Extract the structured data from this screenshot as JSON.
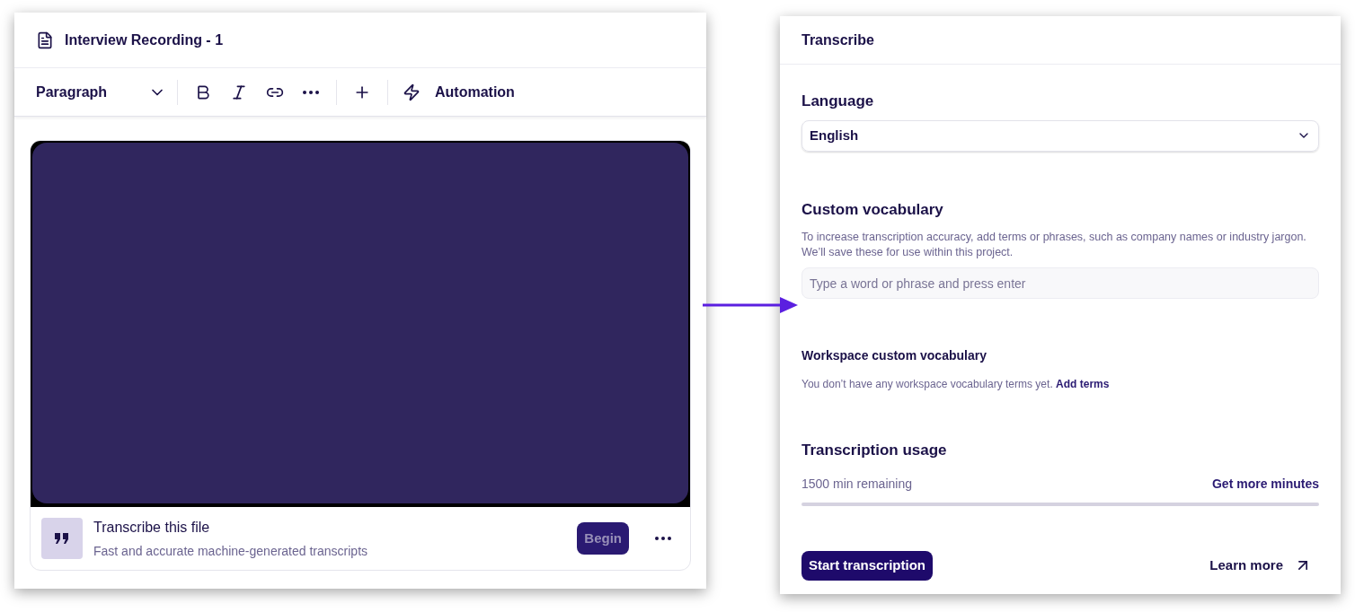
{
  "editor": {
    "title": "Interview Recording - 1",
    "toolbar": {
      "style": "Paragraph",
      "automation": "Automation"
    },
    "transcribe_card": {
      "title": "Transcribe this file",
      "subtitle": "Fast and accurate machine-generated transcripts",
      "button": "Begin"
    }
  },
  "panel": {
    "title": "Transcribe",
    "language": {
      "label": "Language",
      "value": "English"
    },
    "vocabulary": {
      "label": "Custom vocabulary",
      "description": "To increase transcription accuracy, add terms or phrases, such as company names or industry jargon. We’ll save these for use within this project.",
      "placeholder": "Type a word or phrase and press enter"
    },
    "workspace": {
      "label": "Workspace custom vocabulary",
      "text": "You don’t have any workspace vocabulary terms yet.",
      "link": "Add terms"
    },
    "usage": {
      "label": "Transcription usage",
      "remaining": "1500 min remaining",
      "link": "Get more minutes"
    },
    "start_button": "Start transcription",
    "learn_more": "Learn more"
  }
}
